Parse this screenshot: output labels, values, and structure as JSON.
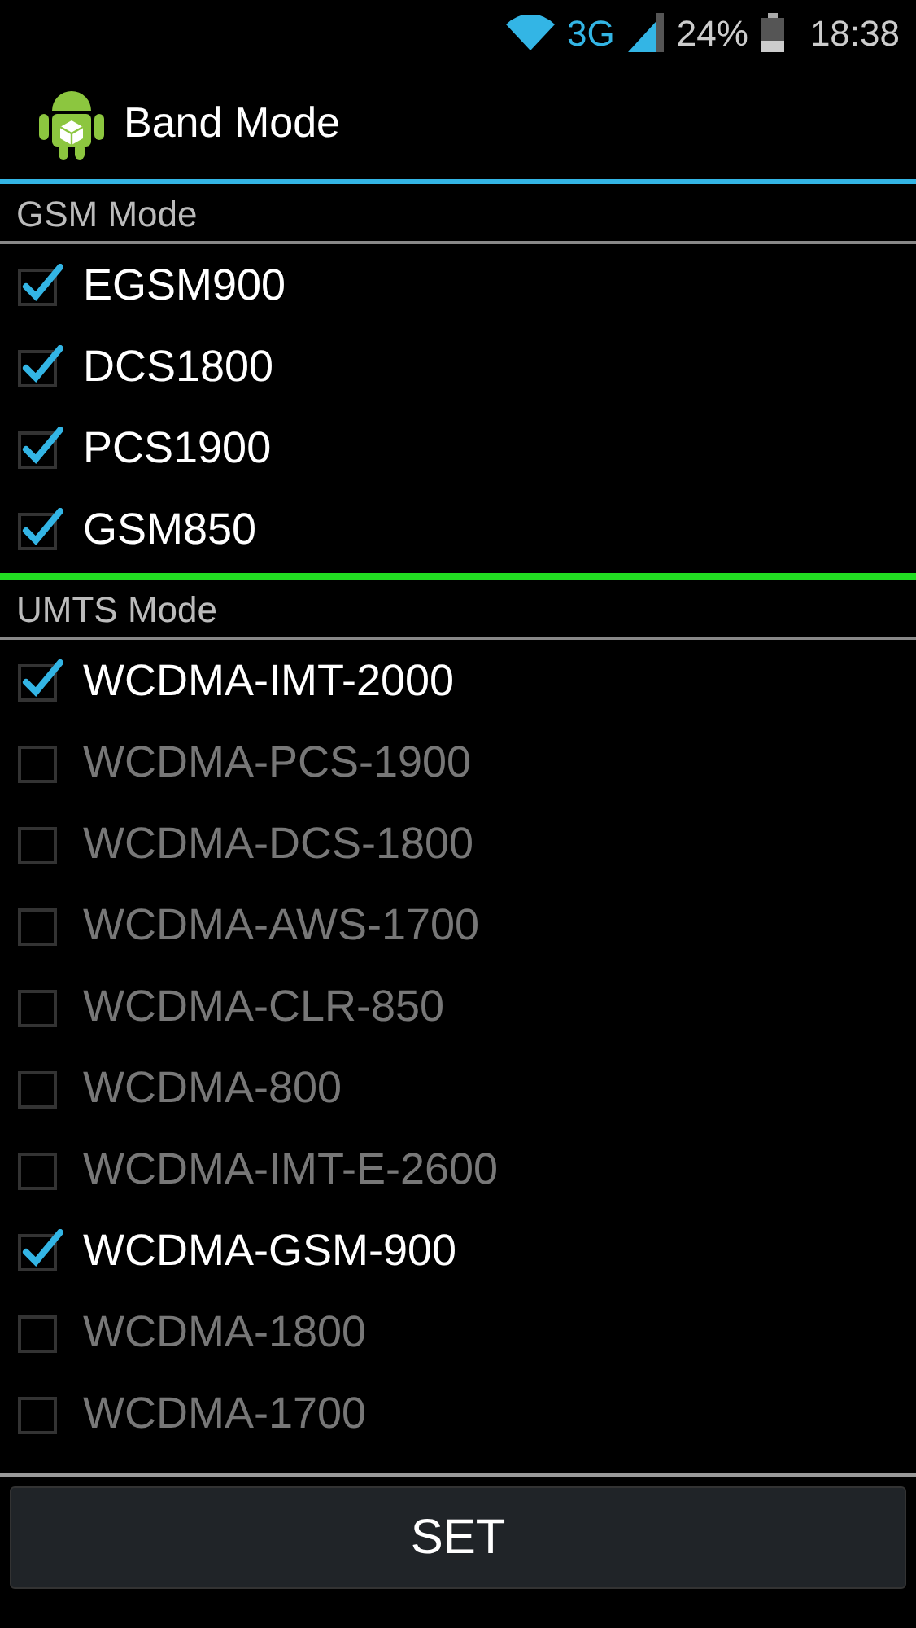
{
  "status_bar": {
    "network": "3G",
    "battery": "24%",
    "time": "18:38"
  },
  "header": {
    "title": "Band Mode"
  },
  "sections": [
    {
      "title": "GSM Mode",
      "items": [
        {
          "label": "EGSM900",
          "checked": true
        },
        {
          "label": "DCS1800",
          "checked": true
        },
        {
          "label": "PCS1900",
          "checked": true
        },
        {
          "label": "GSM850",
          "checked": true
        }
      ]
    },
    {
      "title": "UMTS Mode",
      "items": [
        {
          "label": "WCDMA-IMT-2000",
          "checked": true
        },
        {
          "label": "WCDMA-PCS-1900",
          "checked": false
        },
        {
          "label": "WCDMA-DCS-1800",
          "checked": false
        },
        {
          "label": "WCDMA-AWS-1700",
          "checked": false
        },
        {
          "label": "WCDMA-CLR-850",
          "checked": false
        },
        {
          "label": "WCDMA-800",
          "checked": false
        },
        {
          "label": "WCDMA-IMT-E-2600",
          "checked": false
        },
        {
          "label": "WCDMA-GSM-900",
          "checked": true
        },
        {
          "label": "WCDMA-1800",
          "checked": false
        },
        {
          "label": "WCDMA-1700",
          "checked": false
        }
      ]
    }
  ],
  "buttons": [
    "SET"
  ]
}
